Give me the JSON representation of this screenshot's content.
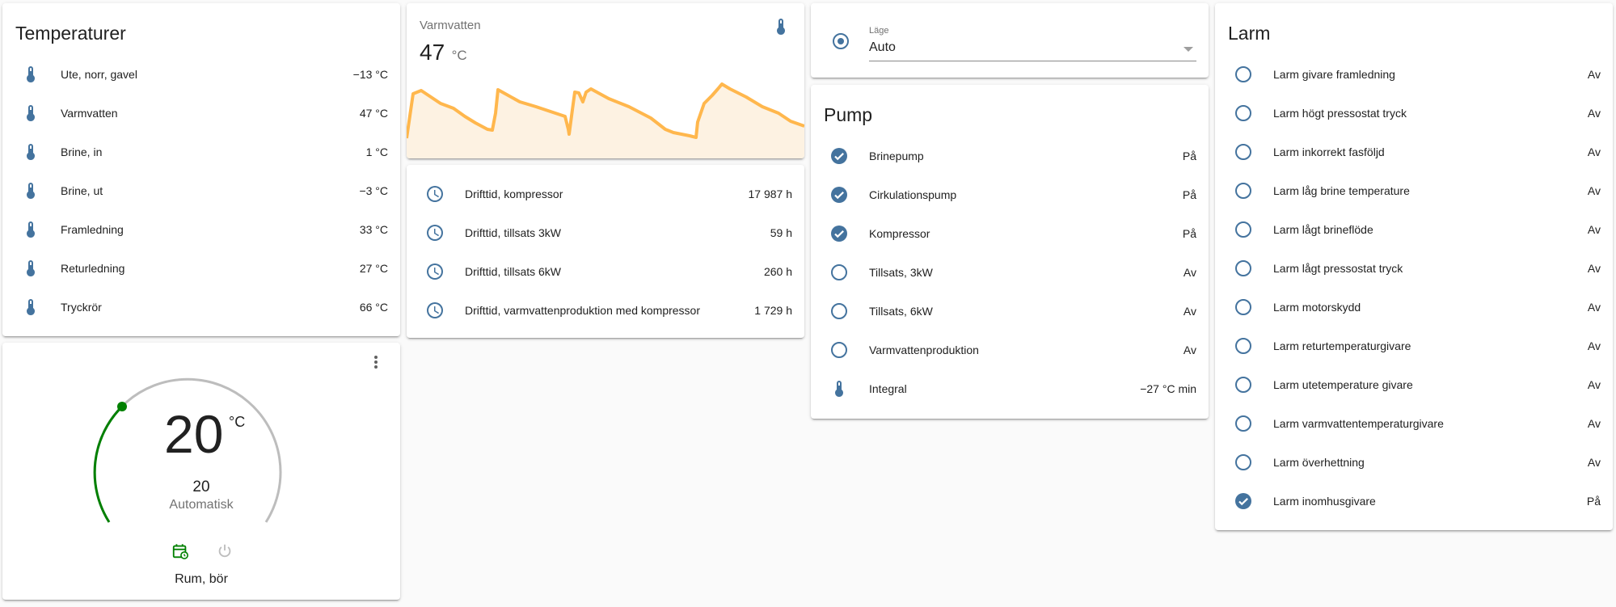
{
  "colors": {
    "accent": "#44739e",
    "graph_line": "#ffb74d",
    "graph_fill": "#fdf2e2",
    "thermostat_arc": "#008000"
  },
  "temperatures": {
    "title": "Temperaturer",
    "rows": [
      {
        "label": "Ute, norr, gavel",
        "value": "−13 °C"
      },
      {
        "label": "Varmvatten",
        "value": "47 °C"
      },
      {
        "label": "Brine, in",
        "value": "1 °C"
      },
      {
        "label": "Brine, ut",
        "value": "−3 °C"
      },
      {
        "label": "Framledning",
        "value": "33 °C"
      },
      {
        "label": "Returledning",
        "value": "27 °C"
      },
      {
        "label": "Tryckrör",
        "value": "66 °C"
      }
    ]
  },
  "thermostat": {
    "value": "20",
    "unit": "°C",
    "target": "20",
    "mode": "Automatisk",
    "name": "Rum, bör",
    "menu_icon": "more-vert-icon",
    "schedule_icon": "calendar-clock-icon",
    "power_icon": "power-icon"
  },
  "varmvatten_graph": {
    "name": "Varmvatten",
    "value": "47",
    "unit": "°C",
    "icon": "thermometer-icon"
  },
  "drifttid": {
    "rows": [
      {
        "label": "Drifttid, kompressor",
        "value": "17 987 h"
      },
      {
        "label": "Drifttid, tillsats 3kW",
        "value": "59 h"
      },
      {
        "label": "Drifttid, tillsats 6kW",
        "value": "260 h"
      },
      {
        "label": "Drifttid, varmvattenproduktion med kompressor",
        "value": "1 729 h"
      }
    ]
  },
  "mode_select": {
    "label": "Läge",
    "value": "Auto"
  },
  "pump": {
    "title": "Pump",
    "rows": [
      {
        "label": "Brinepump",
        "value": "På",
        "icon": "check-circle-icon"
      },
      {
        "label": "Cirkulationspump",
        "value": "På",
        "icon": "check-circle-icon"
      },
      {
        "label": "Kompressor",
        "value": "På",
        "icon": "check-circle-icon"
      },
      {
        "label": "Tillsats, 3kW",
        "value": "Av",
        "icon": "circle-outline-icon"
      },
      {
        "label": "Tillsats, 6kW",
        "value": "Av",
        "icon": "circle-outline-icon"
      },
      {
        "label": "Varmvattenproduktion",
        "value": "Av",
        "icon": "circle-outline-icon"
      },
      {
        "label": "Integral",
        "value": "−27 °C min",
        "icon": "thermometer-icon"
      }
    ]
  },
  "larm": {
    "title": "Larm",
    "rows": [
      {
        "label": "Larm givare framledning",
        "value": "Av"
      },
      {
        "label": "Larm högt pressostat tryck",
        "value": "Av"
      },
      {
        "label": "Larm inkorrekt fasföljd",
        "value": "Av"
      },
      {
        "label": "Larm låg brine temperature",
        "value": "Av"
      },
      {
        "label": "Larm lågt brineflöde",
        "value": "Av"
      },
      {
        "label": "Larm lågt pressostat tryck",
        "value": "Av"
      },
      {
        "label": "Larm motorskydd",
        "value": "Av"
      },
      {
        "label": "Larm returtemperaturgivare",
        "value": "Av"
      },
      {
        "label": "Larm utetemperature givare",
        "value": "Av"
      },
      {
        "label": "Larm varmvattentemperaturgivare",
        "value": "Av"
      },
      {
        "label": "Larm överhettning",
        "value": "Av"
      },
      {
        "label": "Larm inomhusgivare",
        "value": "På"
      }
    ]
  }
}
